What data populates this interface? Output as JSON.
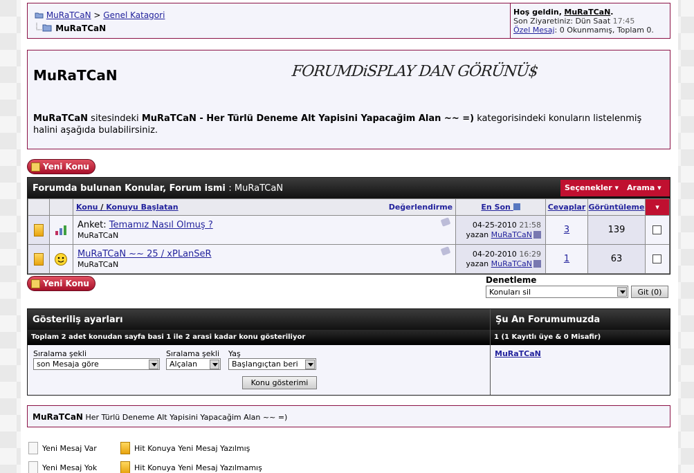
{
  "breadcrumb": {
    "home": "MuRaTCaN",
    "sep": ">",
    "category": "Genel Katagori",
    "current": "MuRaTCaN"
  },
  "userbox": {
    "welcome": "Hoş geldin,",
    "username": "MuRaTCaN",
    "last_visit_label": "Son Ziyaretiniz: Dün Saat",
    "last_visit_time": "17:45",
    "pm_link": "Özel Mesaj",
    "pm_text": ": 0 Okunmamış, Toplam 0."
  },
  "header": {
    "title": "MuRaTCaN",
    "logo_text": "FORUMDiSPLAY DAN GÖRÜNÜ$",
    "intro_p1": "MuRaTCaN",
    "intro_p2": " sitesindeki ",
    "intro_p3": "MuRaTCaN - Her Türlü Deneme Alt Yapisini Yapacağim Alan ~~ =)",
    "intro_p4": " kategorisindeki konuların listelenmiş halini aşağıda bulabilirsiniz."
  },
  "new_topic_label": "Yeni Konu",
  "threads": {
    "heading": "Forumda bulunan Konular, Forum ismi",
    "forum_name": ": MuRaTCaN",
    "options_label": "Seçenekler",
    "search_label": "Arama",
    "columns": {
      "topic": "Konu",
      "sep": " / ",
      "starter": "Konuyu Başlatan",
      "rating": "Değerlendirme",
      "last": "En Son",
      "replies": "Cevaplar",
      "views": "Görüntüleme"
    },
    "rows": [
      {
        "prefix": "Anket: ",
        "title": "Temamız Nasıl Olmuş ?",
        "starter": "MuRaTCaN",
        "date": "04-25-2010",
        "time": "21:58",
        "by": "yazan",
        "last_user": "MuRaTCaN",
        "replies": "3",
        "views": "139",
        "icon": "poll-icon"
      },
      {
        "prefix": "",
        "title": "MuRaTCaN ~~ 25 / xPLanSeR",
        "starter": "MuRaTCaN",
        "date": "04-20-2010",
        "time": "16:29",
        "by": "yazan",
        "last_user": "MuRaTCaN",
        "replies": "1",
        "views": "63",
        "icon": "smiley-icon"
      }
    ]
  },
  "moderation": {
    "label": "Denetleme",
    "selected": "Konuları sil",
    "go": "Git (0)"
  },
  "display": {
    "heading": "Gösteriliş ayarları",
    "summary": "Toplam 2 adet konudan sayfa basi 1 ile 2 arasi kadar konu gösteriliyor",
    "sort_label": "Sıralama şekli",
    "sort_value": "son Mesaja göre",
    "order_label": "Sıralama şekli",
    "order_value": "Alçalan",
    "age_label": "Yaş",
    "age_value": "Başlangıçtan beri",
    "button": "Konu gösterimi"
  },
  "online": {
    "heading": "Şu An Forumumuzda",
    "summary": "1 (1 Kayıtlı üye & 0 Misafir)",
    "user": "MuRaTCaN"
  },
  "footer": {
    "name": "MuRaTCaN",
    "desc": " Her Türlü Deneme Alt Yapisini Yapacağim Alan ~~ =)"
  },
  "legend": {
    "new_posts": "Yeni Mesaj Var",
    "no_new": "Yeni Mesaj Yok",
    "hot_new": "Hit Konuya Yeni Mesaj Yazılmış",
    "hot_none": "Hit Konuya Yeni Mesaj Yazılmamış"
  }
}
